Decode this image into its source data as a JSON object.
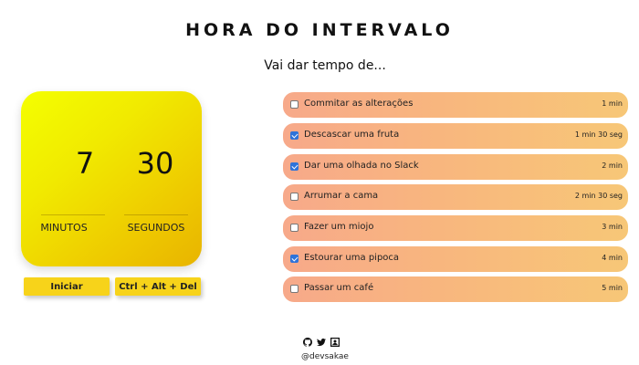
{
  "header": {
    "title": "HORA DO INTERVALO",
    "subtitle": "Vai dar tempo de..."
  },
  "timer": {
    "minutes": "7",
    "seconds": "30",
    "minutes_label": "MINUTOS",
    "seconds_label": "SEGUNDOS"
  },
  "controls": {
    "start_label": "Iniciar",
    "reset_label": "Ctrl + Alt + Del"
  },
  "tasks": [
    {
      "name": "Commitar as alterações",
      "duration": "1 min",
      "checked": false
    },
    {
      "name": "Descascar uma fruta",
      "duration": "1 min 30 seg",
      "checked": true
    },
    {
      "name": "Dar uma olhada no Slack",
      "duration": "2 min",
      "checked": true
    },
    {
      "name": "Arrumar a cama",
      "duration": "2 min 30 seg",
      "checked": false
    },
    {
      "name": "Fazer um miojo",
      "duration": "3 min",
      "checked": false
    },
    {
      "name": "Estourar uma pipoca",
      "duration": "4 min",
      "checked": true
    },
    {
      "name": "Passar um café",
      "duration": "5 min",
      "checked": false
    }
  ],
  "footer": {
    "icons": [
      "github-icon",
      "twitter-icon",
      "profile-card-icon"
    ],
    "handle": "@devsakae"
  },
  "colors": {
    "timer_yellow": "#f1ea00",
    "button_yellow": "#f7d31a",
    "task_gradient_start": "#f7a98a",
    "task_gradient_end": "#f7c777",
    "checkbox_blue": "#2f73d9"
  }
}
